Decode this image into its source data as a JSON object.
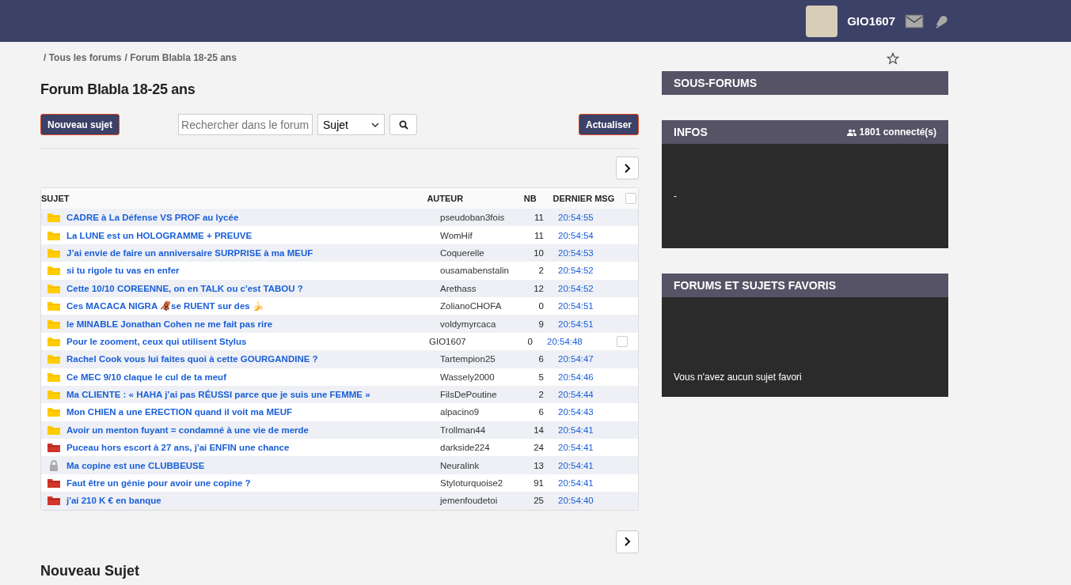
{
  "header": {
    "username": "GIO1607"
  },
  "breadcrumb": [
    "/ Tous les forums",
    "/ Forum Blabla 18-25 ans"
  ],
  "title": "Forum Blabla 18-25 ans",
  "toolbar": {
    "new_topic": "Nouveau sujet",
    "search": {
      "placeholder": "Rechercher dans le forum"
    },
    "scope": "Sujet",
    "refresh": "Actualiser"
  },
  "table": {
    "columns": [
      "SUJET",
      "AUTEUR",
      "NB",
      "DERNIER MSG"
    ],
    "select_all_checked": false,
    "rows": [
      {
        "kind": "folder",
        "title": "CADRE à La Défense VS PROF au lycée",
        "author": "pseudoban3fois",
        "count": "11",
        "time": "20:54:55",
        "own": false
      },
      {
        "kind": "folder",
        "title": "La LUNE est un HOLOGRAMME + PREUVE",
        "author": "WomHif",
        "count": "11",
        "time": "20:54:54",
        "own": false
      },
      {
        "kind": "folder",
        "title": "J’ai envie de faire un anniversaire SURPRISE à ma MEUF",
        "author": "Coquerelle",
        "count": "10",
        "time": "20:54:53",
        "own": false
      },
      {
        "kind": "folder",
        "title": "si tu rigole tu vas en enfer",
        "author": "ousamabenstalin",
        "count": "2",
        "time": "20:54:52",
        "own": false
      },
      {
        "kind": "folder",
        "title": "Cette 10/10 COREENNE, on en TALK ou c'est TABOU ?",
        "author": "Arethass",
        "count": "12",
        "time": "20:54:52",
        "own": false
      },
      {
        "kind": "folder",
        "title": "Ces MACACA NIGRA 🦧se RUENT sur des 🍌",
        "author": "ZolianoCHOFA",
        "count": "0",
        "time": "20:54:51",
        "own": false
      },
      {
        "kind": "folder",
        "title": "le MINABLE Jonathan Cohen ne me fait pas rire",
        "author": "voldymyrcaca",
        "count": "9",
        "time": "20:54:51",
        "own": false
      },
      {
        "kind": "folder",
        "title": "Pour le zooment, ceux qui utilisent Stylus",
        "author": "GIO1607",
        "count": "0",
        "time": "20:54:48",
        "own": true,
        "checked": false
      },
      {
        "kind": "folder",
        "title": "Rachel Cook vous lui faites quoi à cette GOURGANDINE ?",
        "author": "Tartempion25",
        "count": "6",
        "time": "20:54:47",
        "own": false
      },
      {
        "kind": "folder",
        "title": "Ce MEC 9/10 claque le cul de ta meuf",
        "author": "Wassely2000",
        "count": "5",
        "time": "20:54:46",
        "own": false
      },
      {
        "kind": "folder",
        "title": "Ma CLIENTE : « HAHA j’ai pas RÉUSSI parce que je suis une FEMME »",
        "author": "FilsDePoutine",
        "count": "2",
        "time": "20:54:44",
        "own": false
      },
      {
        "kind": "folder",
        "title": "Mon CHIEN a une ERECTION quand il voit ma MEUF",
        "author": "alpacino9",
        "count": "6",
        "time": "20:54:43",
        "own": false
      },
      {
        "kind": "folder",
        "title": "Avoir un menton fuyant = condamné à une vie de merde",
        "author": "Trollman44",
        "count": "14",
        "time": "20:54:41",
        "own": false
      },
      {
        "kind": "hot",
        "title": "Puceau hors escort à 27 ans, j'ai ENFIN une chance",
        "author": "darkside224",
        "count": "24",
        "time": "20:54:41",
        "own": false
      },
      {
        "kind": "locked",
        "title": "Ma copine est une CLUBBEUSE",
        "author": "NeuraIink",
        "count": "13",
        "time": "20:54:41",
        "own": false
      },
      {
        "kind": "hot",
        "title": "Faut être un génie pour avoir une copine ?",
        "author": "Styloturquoise2",
        "count": "91",
        "time": "20:54:41",
        "own": false
      },
      {
        "kind": "hot",
        "title": "j'ai 210 K € en banque",
        "author": "jemenfoudetoi",
        "count": "25",
        "time": "20:54:40",
        "own": false
      }
    ]
  },
  "new_topic_heading": "Nouveau Sujet",
  "sidebar": {
    "subforums": "SOUS-FORUMS",
    "infos": {
      "title": "INFOS",
      "online": "1801 connecté(s)",
      "body": "-"
    },
    "favorites": {
      "title": "FORUMS ET SUJETS FAVORIS",
      "empty": "Vous n'avez aucun sujet favori"
    }
  }
}
